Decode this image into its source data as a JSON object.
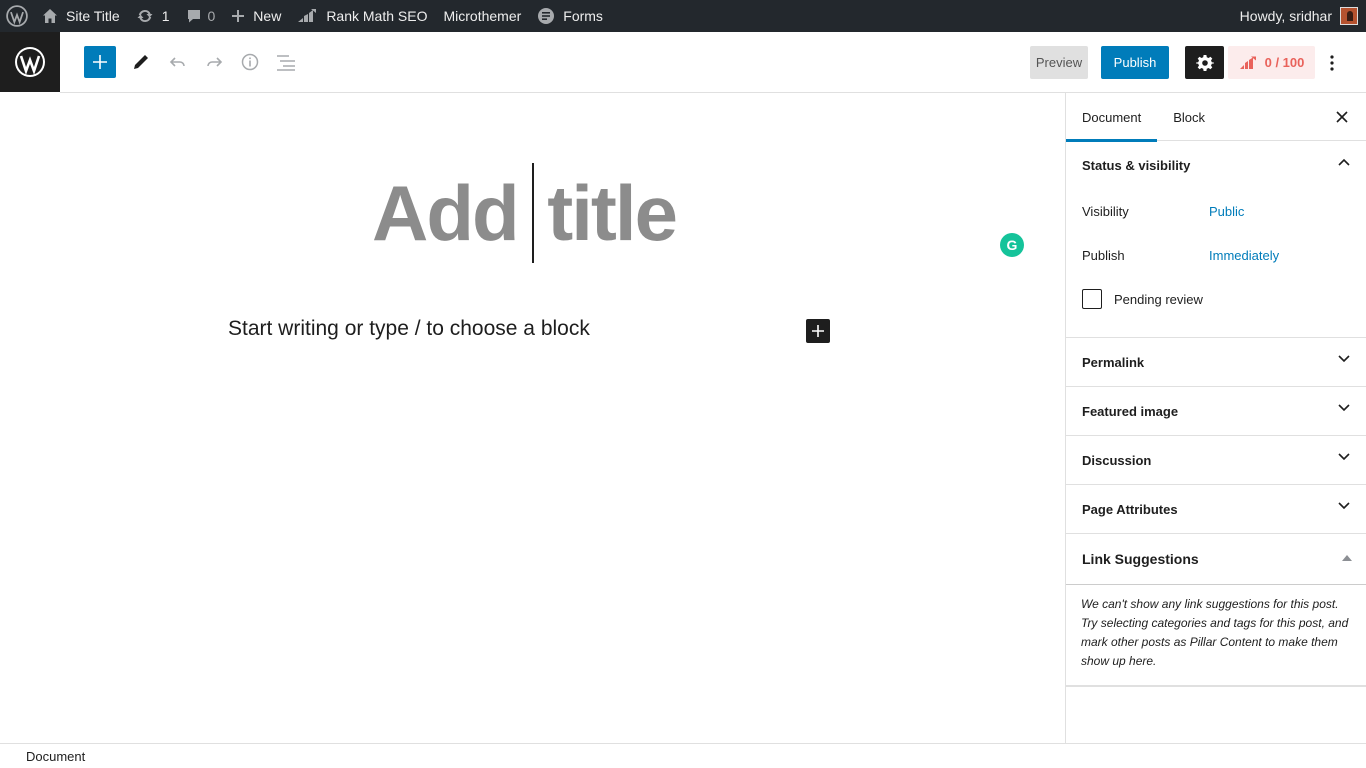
{
  "admin_bar": {
    "site_title": "Site Title",
    "updates_count": "1",
    "comments_count": "0",
    "new_label": "New",
    "rank_math_label": "Rank Math SEO",
    "microthemer_label": "Microthemer",
    "forms_label": "Forms",
    "greeting": "Howdy, sridhar"
  },
  "toolbar": {
    "preview_label": "Preview",
    "publish_label": "Publish",
    "seo_score": "0 / 100"
  },
  "canvas": {
    "title_placeholder": "Add title",
    "body_placeholder": "Start writing or type / to choose a block"
  },
  "sidebar": {
    "tabs": [
      "Document",
      "Block"
    ],
    "status_panel_title": "Status & visibility",
    "visibility_label": "Visibility",
    "visibility_value": "Public",
    "publish_label": "Publish",
    "publish_value": "Immediately",
    "pending_review_label": "Pending review",
    "panels": [
      "Permalink",
      "Featured image",
      "Discussion",
      "Page Attributes"
    ],
    "link_suggestions_title": "Link Suggestions",
    "link_suggestions_text": "We can't show any link suggestions for this post. Try selecting categories and tags for this post, and mark other posts as Pillar Content to make them show up here."
  },
  "footer": {
    "breadcrumb": "Document"
  },
  "colors": {
    "admin_bar_bg": "#23282d",
    "accent": "#007cba",
    "seo_score": "#e9625b",
    "grammarly": "#15c39a"
  }
}
